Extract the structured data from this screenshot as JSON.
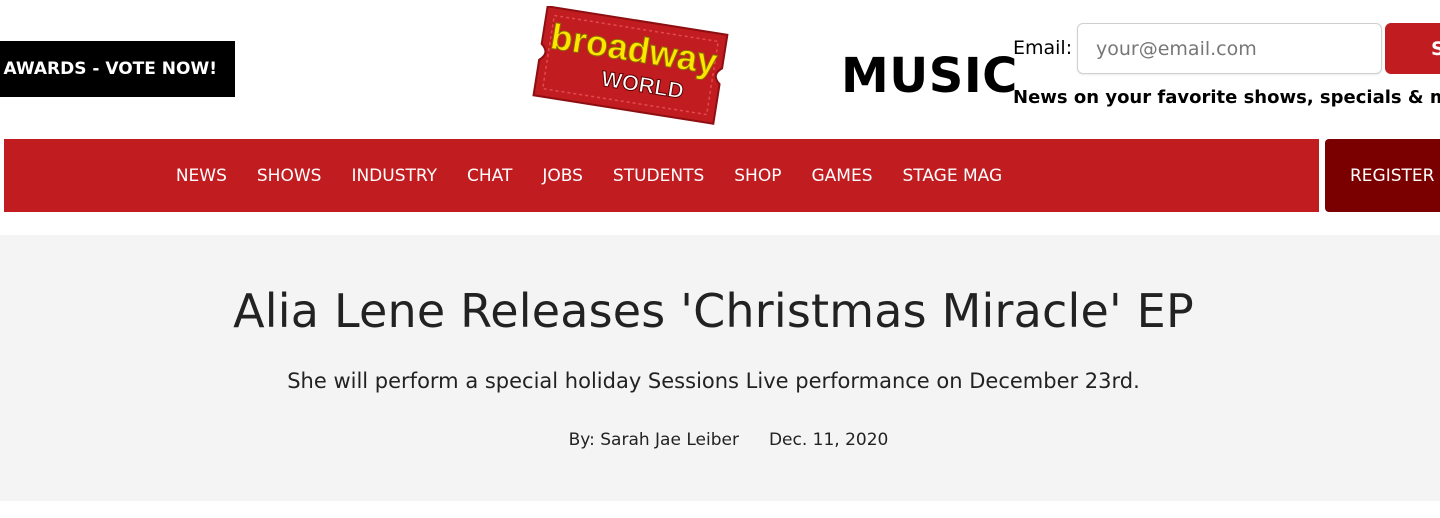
{
  "header": {
    "vote_button": "W AWARDS - VOTE NOW!",
    "logo": {
      "line1": "broadway",
      "line2": "WORLD",
      "color_red": "#c11d21",
      "color_yellow": "#ffe600"
    },
    "section_title": "MUSIC",
    "email_label": "Email:",
    "email_placeholder": "your@email.com",
    "subscribe_label": "S",
    "news_line": "News on your favorite shows, specials & more"
  },
  "nav": {
    "items": [
      "NEWS",
      "SHOWS",
      "INDUSTRY",
      "CHAT",
      "JOBS",
      "STUDENTS",
      "SHOP",
      "GAMES",
      "STAGE MAG"
    ],
    "register_label": "REGISTER",
    "bg_color": "#c11d21",
    "register_bg": "#7a0000"
  },
  "article": {
    "title": "Alia Lene Releases 'Christmas Miracle' EP",
    "subtitle": "She will perform a special holiday Sessions Live performance on December 23rd.",
    "byline_prefix": "By: ",
    "author": "Sarah Jae Leiber",
    "date": "Dec. 11, 2020"
  }
}
